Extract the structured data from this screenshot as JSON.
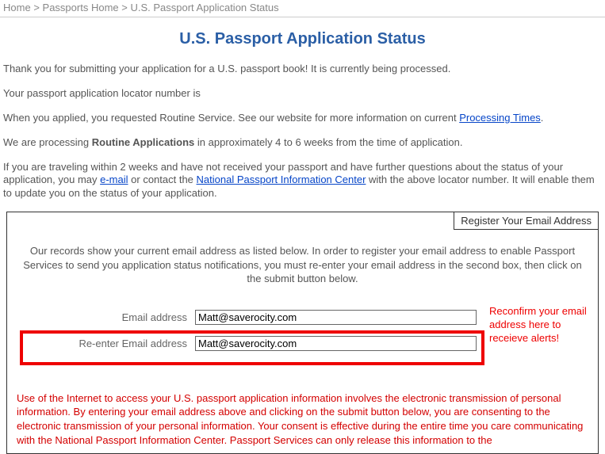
{
  "breadcrumb": {
    "home": "Home",
    "sep": ">",
    "passports_home": "Passports Home",
    "current": "U.S. Passport Application Status"
  },
  "page_title": "U.S. Passport Application Status",
  "intro": {
    "thank_you": "Thank you for submitting your application for a U.S. passport book! It is currently being processed.",
    "locator_label": "Your passport application locator number is",
    "when_applied_pre": "When you applied, you requested Routine Service. See our website for more information on current ",
    "processing_times_link": "Processing Times",
    "period": ".",
    "processing_pre": "We are processing ",
    "routine_bold": "Routine Applications",
    "processing_post": " in approximately 4 to 6 weeks from the time of application.",
    "travel_pre": "If you are traveling within 2 weeks and have not received your passport and have further questions about the status of your application, you may ",
    "email_link": "e-mail",
    "travel_mid": " or contact the ",
    "npic_link": "National Passport Information Center",
    "travel_post": " with the above locator number. It will enable them to update you on the status of your application."
  },
  "register": {
    "tab": "Register Your Email Address",
    "intro": "Our records show your current email address as listed below. In order to register your email address to enable Passport Services to send you application status notifications, you must re-enter your email address in the second box, then click on the submit button below.",
    "email_label": "Email address",
    "reenter_label": "Re-enter Email address",
    "email_value": "Matt@saverocity.com",
    "reenter_value": "Matt@saverocity.com",
    "callout": "Reconfirm your email address here to receieve alerts!",
    "disclaimer": "Use of the Internet to access your U.S. passport application information involves the electronic transmission of personal information. By entering your email address above and clicking on the submit button below, you are consenting to the electronic transmission of your personal information. Your consent is effective during the entire time you care communicating with the National Passport Information Center. Passport Services can only release this information to the"
  }
}
